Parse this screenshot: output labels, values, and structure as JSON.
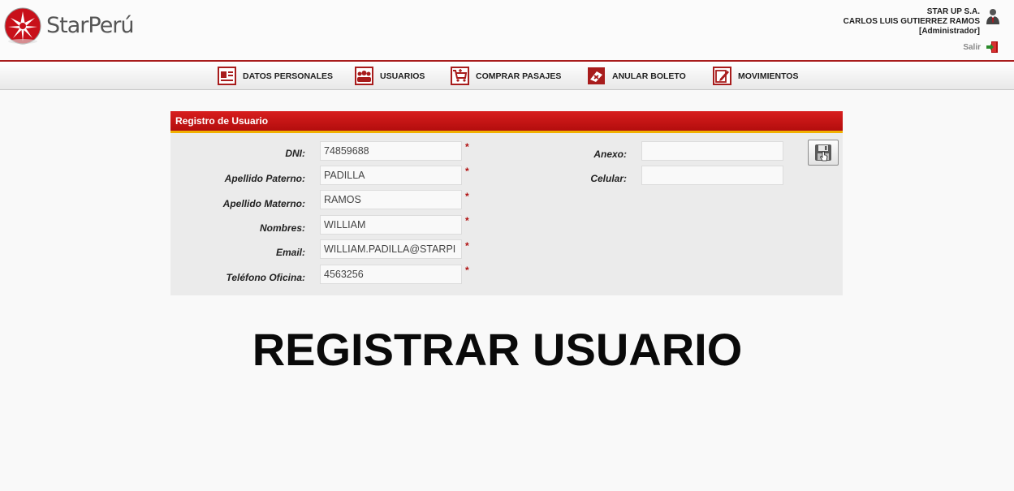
{
  "brand": {
    "name": "StarPerú"
  },
  "user": {
    "company": "STAR UP S.A.",
    "name": "CARLOS LUIS GUTIERREZ RAMOS",
    "role": "[Administrador]",
    "logout_label": "Salir"
  },
  "nav": {
    "items": [
      {
        "label": "DATOS PERSONALES",
        "icon": "id-card-icon"
      },
      {
        "label": "USUARIOS",
        "icon": "users-icon"
      },
      {
        "label": "COMPRAR PASAJES",
        "icon": "cart-icon"
      },
      {
        "label": "ANULAR BOLETO",
        "icon": "cancel-ticket-icon"
      },
      {
        "label": "MOVIMIENTOS",
        "icon": "edit-icon"
      }
    ]
  },
  "form": {
    "title": "Registro de Usuario",
    "required_mark": "*",
    "fields": {
      "dni": {
        "label": "DNI:",
        "value": "74859688"
      },
      "apellido_paterno": {
        "label": "Apellido Paterno:",
        "value": "PADILLA"
      },
      "apellido_materno": {
        "label": "Apellido Materno:",
        "value": "RAMOS"
      },
      "nombres": {
        "label": "Nombres:",
        "value": "WILLIAM"
      },
      "email": {
        "label": "Email:",
        "value": "WILLIAM.PADILLA@STARPI"
      },
      "telefono": {
        "label": "Teléfono Oficina:",
        "value": "4563256"
      },
      "anexo": {
        "label": "Anexo:",
        "value": ""
      },
      "celular": {
        "label": "Celular:",
        "value": ""
      }
    },
    "save_icon": "floppy-disk-icon"
  },
  "caption": "REGISTRAR USUARIO",
  "colors": {
    "brand_red": "#c8101a",
    "accent_yellow": "#f0b000",
    "panel_bg": "#ebebeb"
  }
}
